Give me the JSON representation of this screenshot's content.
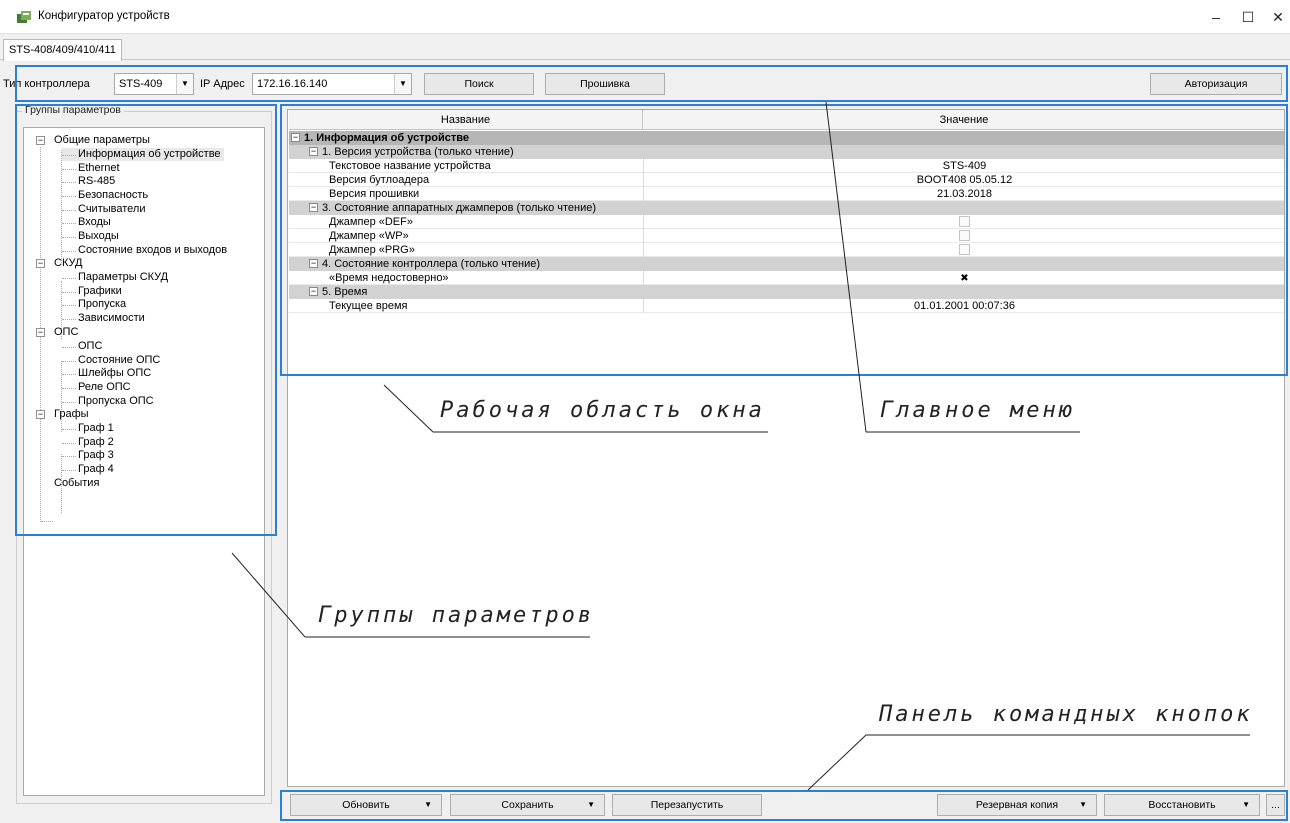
{
  "window": {
    "title": "Конфигуратор устройств",
    "minimize": "–",
    "maximize": "☐",
    "close": "✕"
  },
  "tab": {
    "label": "STS-408/409/410/411"
  },
  "toolbar": {
    "controller_type_label": "Тип контроллера",
    "controller_type_value": "STS-409",
    "ip_label": "IP Адрес",
    "ip_value": "172.16.16.140",
    "search_label": "Поиск",
    "firmware_label": "Прошивка",
    "auth_label": "Авторизация"
  },
  "tree": {
    "group_title": "Группы параметров",
    "items": [
      {
        "label": "Общие параметры"
      },
      {
        "label": "Информация об устройстве"
      },
      {
        "label": "Ethernet"
      },
      {
        "label": "RS-485"
      },
      {
        "label": "Безопасность"
      },
      {
        "label": "Считыватели"
      },
      {
        "label": "Входы"
      },
      {
        "label": "Выходы"
      },
      {
        "label": "Состояние входов и выходов"
      },
      {
        "label": "СКУД"
      },
      {
        "label": "Параметры СКУД"
      },
      {
        "label": "Графики"
      },
      {
        "label": "Пропуска"
      },
      {
        "label": "Зависимости"
      },
      {
        "label": "ОПС"
      },
      {
        "label": "ОПС"
      },
      {
        "label": "Состояние ОПС"
      },
      {
        "label": "Шлейфы ОПС"
      },
      {
        "label": "Реле ОПС"
      },
      {
        "label": "Пропуска ОПС"
      },
      {
        "label": "Графы"
      },
      {
        "label": "Граф 1"
      },
      {
        "label": "Граф 2"
      },
      {
        "label": "Граф 3"
      },
      {
        "label": "Граф 4"
      },
      {
        "label": "События"
      }
    ]
  },
  "grid": {
    "col_name": "Название",
    "col_value": "Значение",
    "rows": [
      {
        "kind": "section",
        "name": "1. Информация об устройстве"
      },
      {
        "kind": "subsection",
        "name": "1. Версия устройства (только чтение)"
      },
      {
        "kind": "prop",
        "name": "Текстовое название устройства",
        "value": "STS-409"
      },
      {
        "kind": "prop",
        "name": "Версия бутлоадера",
        "value": "BOOT408 05.05.12"
      },
      {
        "kind": "prop",
        "name": "Версия прошивки",
        "value": "21.03.2018"
      },
      {
        "kind": "subsection",
        "name": "3. Состояние аппаратных джамперов (только чтение)"
      },
      {
        "kind": "prop",
        "name": "Джампер «DEF»",
        "checked": false
      },
      {
        "kind": "prop",
        "name": "Джампер «WP»",
        "checked": false
      },
      {
        "kind": "prop",
        "name": "Джампер «PRG»",
        "checked": false
      },
      {
        "kind": "subsection",
        "name": "4. Состояние контроллера (только чтение)"
      },
      {
        "kind": "prop",
        "name": "«Время недостоверно»",
        "checked": true
      },
      {
        "kind": "subsection",
        "name": "5. Время"
      },
      {
        "kind": "prop",
        "name": "Текущее время",
        "value": "01.01.2001 00:07:36"
      }
    ]
  },
  "bottom": {
    "refresh": "Обновить",
    "save": "Сохранить",
    "restart": "Перезапустить",
    "backup": "Резервная копия",
    "restore": "Восстановить",
    "more": "..."
  },
  "annotations": {
    "work_area": "Рабочая область окна",
    "main_menu": "Главное меню",
    "param_groups": "Группы параметров",
    "button_panel": "Панель командных кнопок"
  },
  "colors": {
    "highlight": "#2d7fd6",
    "section_bg": "#b6b6b6",
    "subsection_bg": "#d2d2d2"
  }
}
